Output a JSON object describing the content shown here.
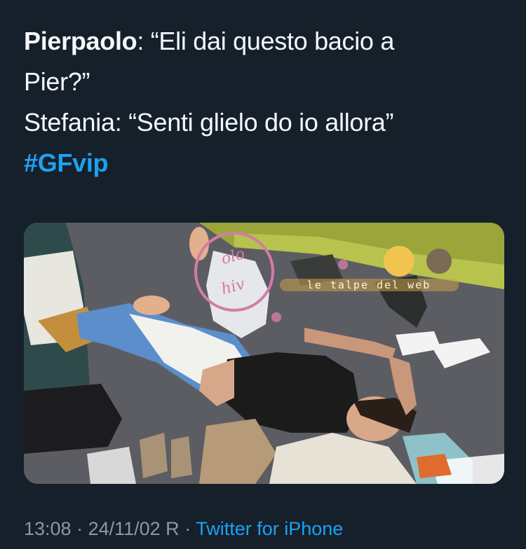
{
  "tweet": {
    "line1_speaker": "Pierpaolo",
    "line1_text": ": “Eli dai questo bacio a",
    "line2_text": "Pier?”",
    "line3_text": "Stefania: “Senti glielo do io allora”",
    "hashtag": "#GFvip"
  },
  "media": {
    "watermark_text": "le talpe del web"
  },
  "meta": {
    "time": "13:08",
    "separator": " · ",
    "date": "24/11/02 R",
    "separator2": " · ",
    "source": "Twitter for iPhone"
  },
  "colors": {
    "background": "#15202b",
    "text": "#f5f8fa",
    "link": "#1da1f2",
    "meta": "#8899a6"
  }
}
